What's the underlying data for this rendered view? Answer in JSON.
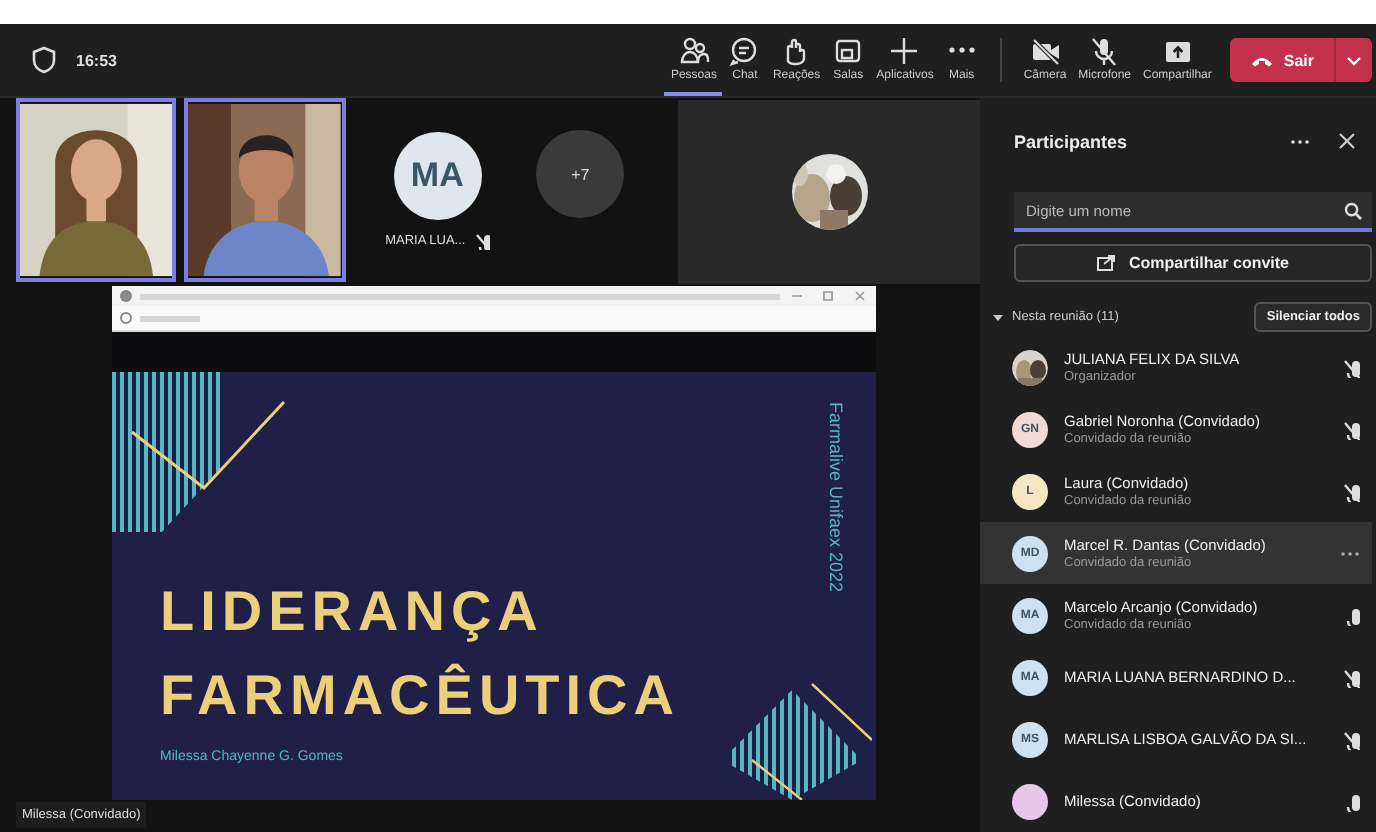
{
  "top_bar": {
    "time": "16:53",
    "tools": [
      {
        "label": "Pessoas",
        "kind": "people",
        "selected": true
      },
      {
        "label": "Chat",
        "kind": "chat",
        "selected": false
      },
      {
        "label": "Reações",
        "kind": "hand",
        "selected": false
      },
      {
        "label": "Salas",
        "kind": "rooms",
        "selected": false
      },
      {
        "label": "Aplicativos",
        "kind": "plus",
        "selected": false
      },
      {
        "label": "Mais",
        "kind": "more",
        "selected": false
      }
    ],
    "devices": [
      {
        "label": "Câmera",
        "kind": "camera_off"
      },
      {
        "label": "Microfone",
        "kind": "mic_off"
      },
      {
        "label": "Compartilhar",
        "kind": "share"
      }
    ],
    "leave_button": {
      "label": "Sair"
    }
  },
  "video_strip": {
    "tiles": [
      {
        "kind": "picture"
      },
      {
        "kind": "picture"
      },
      {
        "kind": "avatar",
        "initials": "MA",
        "name": "MARIA LUA...",
        "muted": true
      },
      {
        "kind": "overflow",
        "count": "+7"
      }
    ],
    "spotlight": {
      "kind": "photo_avatar"
    }
  },
  "shared_screen": {
    "slide": {
      "title_lines": [
        "LIDERANÇA",
        "FARMACÊUTICA"
      ],
      "author": "Milessa Chayenne G. Gomes",
      "side_text": "Farmalive Unifaex 2022"
    },
    "presenter": "Milessa (Convidado)"
  },
  "participants_panel": {
    "title": "Participantes",
    "search": {
      "placeholder": "Digite um nome"
    },
    "invite_button": "Compartilhar convite",
    "section": {
      "label": "Nesta reunião (11)",
      "expanded": true,
      "mute_all": "Silenciar todos"
    },
    "people": [
      {
        "name": "JULIANA FELIX DA SILVA",
        "role": "Organizador",
        "muted": true,
        "selected": false
      },
      {
        "kind": "initials",
        "name": "Gabriel Noronha (Convidado)",
        "role": "Convidado da reunião",
        "initials": "GN",
        "color": "#f2d9d6",
        "muted": true,
        "selected": false
      },
      {
        "kind": "initials",
        "name": "Laura (Convidado)",
        "role": "Convidado da reunião",
        "initials": "L",
        "color": "#f4e8c4",
        "muted": true,
        "selected": false
      },
      {
        "kind": "initials",
        "name": "Marcel R. Dantas (Convidado)",
        "role": "Convidado da reunião",
        "initials": "MD",
        "color": "#cfe0f0",
        "selected": true
      },
      {
        "kind": "initials",
        "name": "Marcelo Arcanjo (Convidado)",
        "role": "Convidado da reunião",
        "initials": "MA",
        "color": "#cfe0f0",
        "muted": false,
        "selected": false
      },
      {
        "kind": "initials",
        "name": "MARIA LUANA BERNARDINO D...",
        "initials": "MA",
        "color": "#cfe0f0",
        "muted": true,
        "selected": false
      },
      {
        "kind": "initials",
        "name": "MARLISA LISBOA GALVÃO DA SI...",
        "initials": "MS",
        "color": "#cfe0f0",
        "muted": true,
        "selected": false
      },
      {
        "kind": "initials",
        "name": "Milessa (Convidado)",
        "color": "#e8c6ec",
        "muted": false,
        "selected": false
      }
    ]
  }
}
